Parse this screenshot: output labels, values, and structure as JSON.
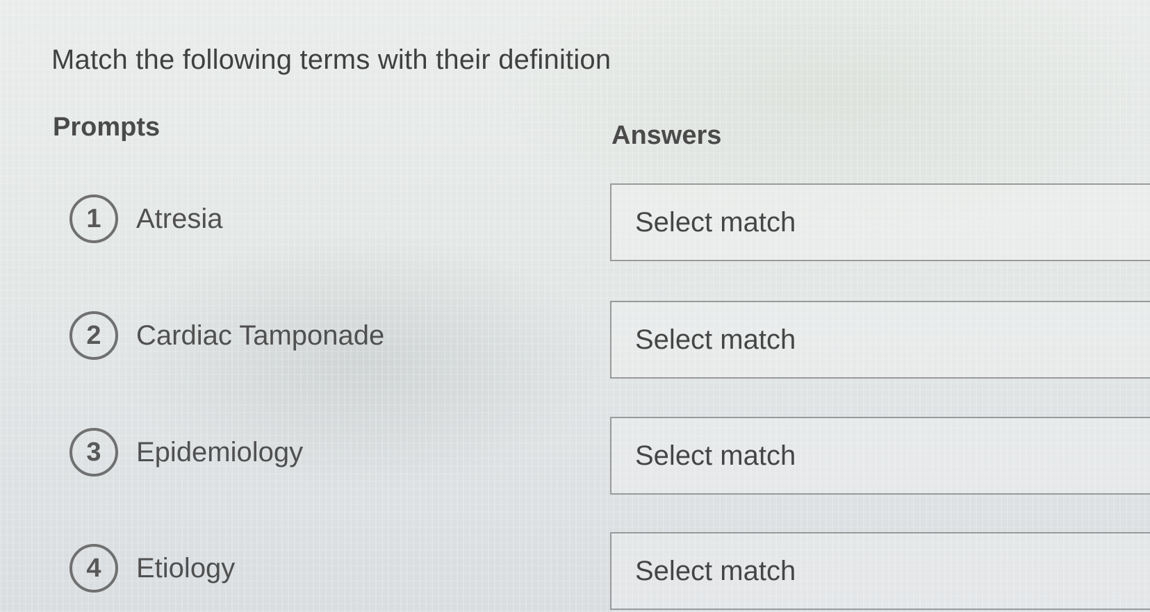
{
  "question": {
    "title": "Match the following terms with their definition"
  },
  "columns": {
    "prompts_heading": "Prompts",
    "answers_heading": "Answers"
  },
  "prompts": [
    {
      "number": "1",
      "label": "Atresia"
    },
    {
      "number": "2",
      "label": "Cardiac Tamponade"
    },
    {
      "number": "3",
      "label": "Epidemiology"
    },
    {
      "number": "4",
      "label": "Etiology"
    }
  ],
  "answers": [
    {
      "value": "Select match"
    },
    {
      "value": "Select match"
    },
    {
      "value": "Select match"
    },
    {
      "value": "Select match"
    }
  ]
}
